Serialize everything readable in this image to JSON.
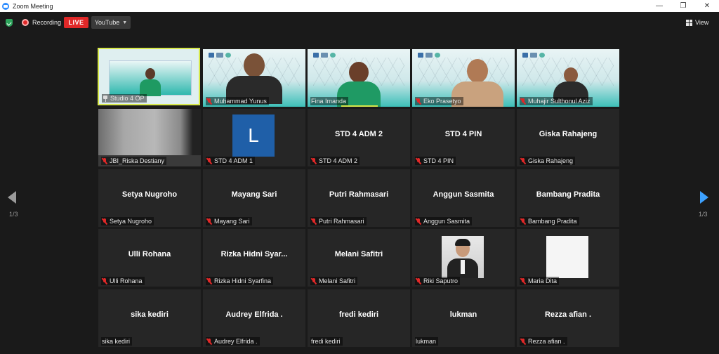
{
  "window": {
    "title": "Zoom Meeting"
  },
  "toolbar": {
    "recording_label": "Recording",
    "live_label": "LIVE",
    "stream_target": "YouTube",
    "view_label": "View"
  },
  "pagination": {
    "left_indicator": "1/3",
    "right_indicator": "1/3"
  },
  "colors": {
    "live": "#e02828",
    "active_speaker": "#d7e84b",
    "nav_arrow": "#3da1ff"
  },
  "tiles": [
    {
      "name": "Studio 4 OP",
      "display": "",
      "muted": false,
      "pinned": true,
      "kind": "video"
    },
    {
      "name": "Muhammad Yunus",
      "display": "",
      "muted": true,
      "kind": "video"
    },
    {
      "name": "Fina Imanda",
      "display": "",
      "muted": false,
      "kind": "video"
    },
    {
      "name": "Eko Prasetyo",
      "display": "",
      "muted": true,
      "kind": "video"
    },
    {
      "name": "Muhajir Sulthonul Aziz",
      "display": "",
      "muted": true,
      "kind": "video"
    },
    {
      "name": "JBI_Riska Destiany",
      "display": "",
      "muted": true,
      "kind": "video"
    },
    {
      "name": "STD 4 ADM 1",
      "display": "L",
      "muted": true,
      "kind": "avatar"
    },
    {
      "name": "STD 4 ADM 2",
      "display": "STD 4 ADM 2",
      "muted": true,
      "kind": "text"
    },
    {
      "name": "STD 4 PIN",
      "display": "STD 4 PIN",
      "muted": true,
      "kind": "text"
    },
    {
      "name": "Giska Rahajeng",
      "display": "Giska Rahajeng",
      "muted": true,
      "kind": "text"
    },
    {
      "name": "Setya Nugroho",
      "display": "Setya Nugroho",
      "muted": true,
      "kind": "text"
    },
    {
      "name": "Mayang Sari",
      "display": "Mayang Sari",
      "muted": true,
      "kind": "text"
    },
    {
      "name": "Putri Rahmasari",
      "display": "Putri Rahmasari",
      "muted": true,
      "kind": "text"
    },
    {
      "name": "Anggun Sasmita",
      "display": "Anggun Sasmita",
      "muted": true,
      "kind": "text"
    },
    {
      "name": "Bambang Pradita",
      "display": "Bambang Pradita",
      "muted": true,
      "kind": "text"
    },
    {
      "name": "Ulli Rohana",
      "display": "Ulli Rohana",
      "muted": true,
      "kind": "text"
    },
    {
      "name": "Rizka Hidni Syarfina",
      "display": "Rizka  Hidni  Syar...",
      "muted": true,
      "kind": "text"
    },
    {
      "name": "Melani Safitri",
      "display": "Melani Safitri",
      "muted": true,
      "kind": "text"
    },
    {
      "name": "Riki Saputro",
      "display": "",
      "muted": true,
      "kind": "photo"
    },
    {
      "name": "Maria Dita",
      "display": "",
      "muted": true,
      "kind": "blank"
    },
    {
      "name": "sika kediri",
      "display": "sika kediri",
      "muted": false,
      "kind": "text"
    },
    {
      "name": "Audrey Elfrida .",
      "display": "Audrey Elfrida .",
      "muted": true,
      "kind": "text"
    },
    {
      "name": "fredi kediri",
      "display": "fredi kediri",
      "muted": false,
      "kind": "text"
    },
    {
      "name": "lukman",
      "display": "lukman",
      "muted": false,
      "kind": "text"
    },
    {
      "name": "Rezza afian .",
      "display": "Rezza afian .",
      "muted": true,
      "kind": "text"
    }
  ]
}
